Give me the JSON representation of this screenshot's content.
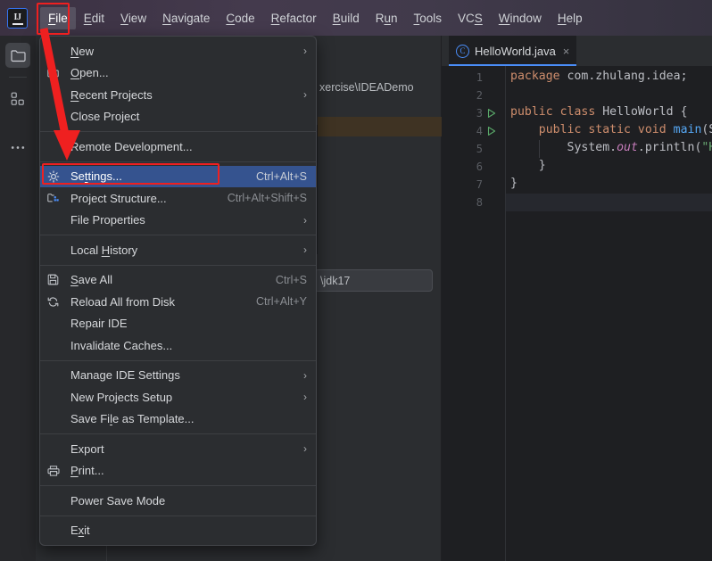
{
  "app": {
    "logo_text": "IJ",
    "logo_name": "intellij-idea-logo"
  },
  "menubar": {
    "items": [
      {
        "label": "File",
        "mnemonic": "F",
        "active": true
      },
      {
        "label": "Edit",
        "mnemonic": "E",
        "active": false
      },
      {
        "label": "View",
        "mnemonic": "V",
        "active": false
      },
      {
        "label": "Navigate",
        "mnemonic": "N",
        "active": false
      },
      {
        "label": "Code",
        "mnemonic": "C",
        "active": false
      },
      {
        "label": "Refactor",
        "mnemonic": "R",
        "active": false
      },
      {
        "label": "Build",
        "mnemonic": "B",
        "active": false
      },
      {
        "label": "Run",
        "mnemonic": "u",
        "active": false
      },
      {
        "label": "Tools",
        "mnemonic": "T",
        "active": false
      },
      {
        "label": "VCS",
        "mnemonic": "S",
        "active": false
      },
      {
        "label": "Window",
        "mnemonic": "W",
        "active": false
      },
      {
        "label": "Help",
        "mnemonic": "H",
        "active": false
      }
    ]
  },
  "toolstrip": {
    "buttons": [
      {
        "name": "project-tool-window-icon",
        "selected": true
      },
      {
        "name": "structure-tool-window-icon",
        "selected": false
      },
      {
        "name": "more-tool-windows-icon",
        "selected": false
      }
    ]
  },
  "file_menu": {
    "title": "File",
    "items": [
      {
        "label": "New",
        "mnemonic": "N",
        "icon": "",
        "shortcut": "",
        "submenu": true,
        "selected": false
      },
      {
        "label": "Open...",
        "mnemonic": "O",
        "icon": "folder-icon",
        "shortcut": "",
        "submenu": false,
        "selected": false
      },
      {
        "label": "Recent Projects",
        "mnemonic": "R",
        "icon": "",
        "shortcut": "",
        "submenu": true,
        "selected": false
      },
      {
        "label": "Close Project",
        "mnemonic": "",
        "icon": "",
        "shortcut": "",
        "submenu": false,
        "selected": false
      },
      {
        "separator": true
      },
      {
        "label": "Remote Development...",
        "mnemonic": "",
        "icon": "",
        "shortcut": "",
        "submenu": false,
        "selected": false
      },
      {
        "separator": true
      },
      {
        "label": "Settings...",
        "mnemonic": "t",
        "icon": "gear-icon",
        "shortcut": "Ctrl+Alt+S",
        "submenu": false,
        "selected": true
      },
      {
        "label": "Project Structure...",
        "mnemonic": "",
        "icon": "project-structure-icon",
        "shortcut": "Ctrl+Alt+Shift+S",
        "submenu": false,
        "selected": false
      },
      {
        "label": "File Properties",
        "mnemonic": "",
        "icon": "",
        "shortcut": "",
        "submenu": true,
        "selected": false
      },
      {
        "separator": true
      },
      {
        "label": "Local History",
        "mnemonic": "H",
        "icon": "",
        "shortcut": "",
        "submenu": true,
        "selected": false
      },
      {
        "separator": true
      },
      {
        "label": "Save All",
        "mnemonic": "S",
        "icon": "save-icon",
        "shortcut": "Ctrl+S",
        "submenu": false,
        "selected": false
      },
      {
        "label": "Reload All from Disk",
        "mnemonic": "",
        "icon": "reload-icon",
        "shortcut": "Ctrl+Alt+Y",
        "submenu": false,
        "selected": false
      },
      {
        "label": "Repair IDE",
        "mnemonic": "",
        "icon": "",
        "shortcut": "",
        "submenu": false,
        "selected": false
      },
      {
        "label": "Invalidate Caches...",
        "mnemonic": "",
        "icon": "",
        "shortcut": "",
        "submenu": false,
        "selected": false
      },
      {
        "separator": true
      },
      {
        "label": "Manage IDE Settings",
        "mnemonic": "",
        "icon": "",
        "shortcut": "",
        "submenu": true,
        "selected": false
      },
      {
        "label": "New Projects Setup",
        "mnemonic": "",
        "icon": "",
        "shortcut": "",
        "submenu": true,
        "selected": false
      },
      {
        "label": "Save File as Template...",
        "mnemonic": "l",
        "icon": "",
        "shortcut": "",
        "submenu": false,
        "selected": false
      },
      {
        "separator": true
      },
      {
        "label": "Export",
        "mnemonic": "",
        "icon": "",
        "shortcut": "",
        "submenu": true,
        "selected": false
      },
      {
        "label": "Print...",
        "mnemonic": "P",
        "icon": "print-icon",
        "shortcut": "",
        "submenu": false,
        "selected": false
      },
      {
        "separator": true
      },
      {
        "label": "Power Save Mode",
        "mnemonic": "",
        "icon": "",
        "shortcut": "",
        "submenu": false,
        "selected": false
      },
      {
        "separator": true
      },
      {
        "label": "Exit",
        "mnemonic": "x",
        "icon": "",
        "shortcut": "",
        "submenu": false,
        "selected": false
      }
    ]
  },
  "annotations": {
    "color": "#ef2020",
    "file_menu_box": {
      "name": "file-menu-highlight-box"
    },
    "settings_box": {
      "name": "settings-item-highlight-box"
    },
    "arrow": {
      "name": "pointer-arrow-to-settings"
    }
  },
  "background": {
    "project_path": "xercise\\IDEADemo",
    "sdk_field_value": "\\jdk17"
  },
  "editor": {
    "tab": {
      "filename": "HelloWorld.java",
      "icon_letter": "C",
      "close_glyph": "×"
    },
    "lines": [
      {
        "num": "1",
        "run_marker": false,
        "tokens": [
          {
            "t": "package ",
            "c": "kw"
          },
          {
            "t": "com.zhulang.idea;",
            "c": "pl"
          }
        ]
      },
      {
        "num": "2",
        "run_marker": false,
        "tokens": []
      },
      {
        "num": "3",
        "run_marker": true,
        "tokens": [
          {
            "t": "public class ",
            "c": "kw"
          },
          {
            "t": "HelloWorld",
            "c": "cls"
          },
          {
            "t": " {",
            "c": "pl"
          }
        ]
      },
      {
        "num": "4",
        "run_marker": true,
        "tokens": [
          {
            "t": "    public static void ",
            "c": "kw"
          },
          {
            "t": "main",
            "c": "mth"
          },
          {
            "t": "(S",
            "c": "pl"
          }
        ]
      },
      {
        "num": "5",
        "run_marker": false,
        "tokens": [
          {
            "t": "        System.",
            "c": "pl"
          },
          {
            "t": "out",
            "c": "fld"
          },
          {
            "t": ".println(",
            "c": "pl"
          },
          {
            "t": "\"H",
            "c": "str"
          }
        ]
      },
      {
        "num": "6",
        "run_marker": false,
        "tokens": [
          {
            "t": "    }",
            "c": "pl"
          }
        ]
      },
      {
        "num": "7",
        "run_marker": false,
        "tokens": [
          {
            "t": "}",
            "c": "pl"
          }
        ]
      },
      {
        "num": "8",
        "run_marker": false,
        "tokens": []
      }
    ],
    "caret_line_index": 7
  }
}
